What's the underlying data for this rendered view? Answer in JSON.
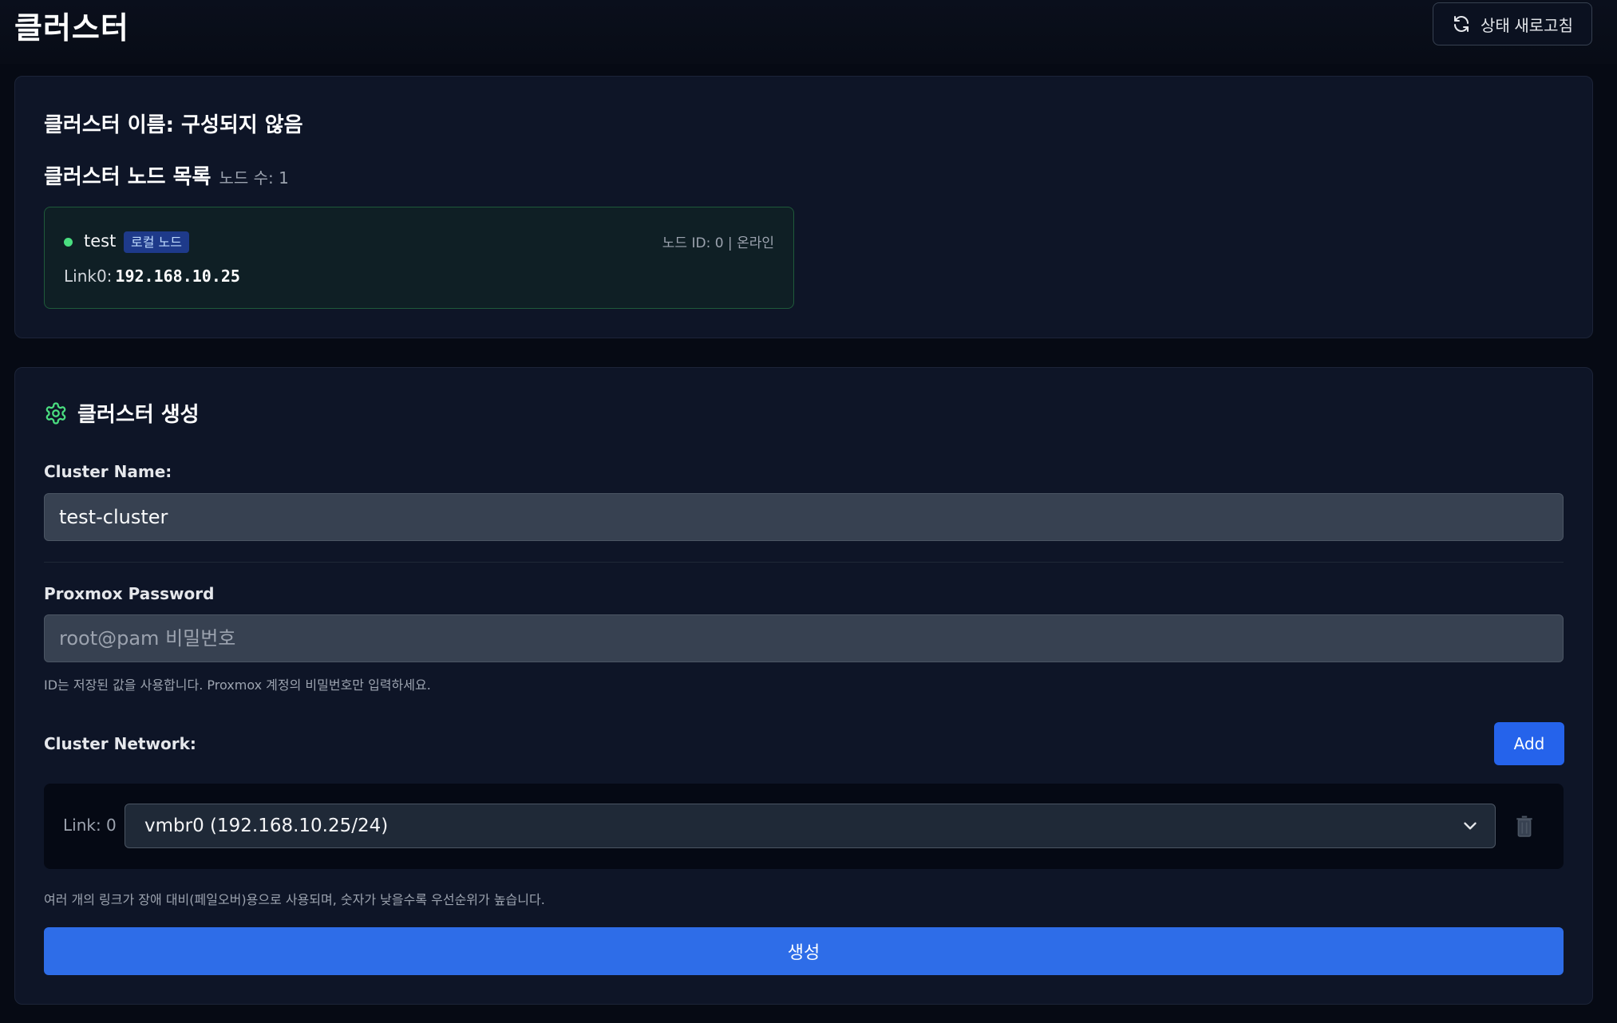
{
  "header": {
    "title": "클러스터",
    "refresh_label": "상태 새로고침"
  },
  "cluster_info": {
    "name_heading": "클러스터 이름: 구성되지 않음",
    "nodes_heading": "클러스터 노드 목록",
    "node_count": "노드 수: 1",
    "nodes": [
      {
        "name": "test",
        "badge": "로컬 노드",
        "meta": "노드 ID: 0 | 온라인",
        "link_label": "Link0:",
        "link_ip": "192.168.10.25",
        "status_color": "#4ade80"
      }
    ]
  },
  "create": {
    "title": "클러스터 생성",
    "cluster_name_label": "Cluster Name:",
    "cluster_name_value": "test-cluster",
    "password_label": "Proxmox Password",
    "password_placeholder": "root@pam 비밀번호",
    "password_hint": "ID는 저장된 값을 사용합니다. Proxmox 계정의 비밀번호만 입력하세요.",
    "network_label": "Cluster Network:",
    "add_label": "Add",
    "links": [
      {
        "label": "Link: 0",
        "selected": "vmbr0 (192.168.10.25/24)"
      }
    ],
    "network_hint": "여러 개의 링크가 장애 대비(페일오버)용으로 사용되며, 숫자가 낮을수록 우선순위가 높습니다.",
    "submit_label": "생성"
  },
  "colors": {
    "accent": "#2563eb",
    "online": "#4ade80",
    "gear": "#4ade80"
  }
}
